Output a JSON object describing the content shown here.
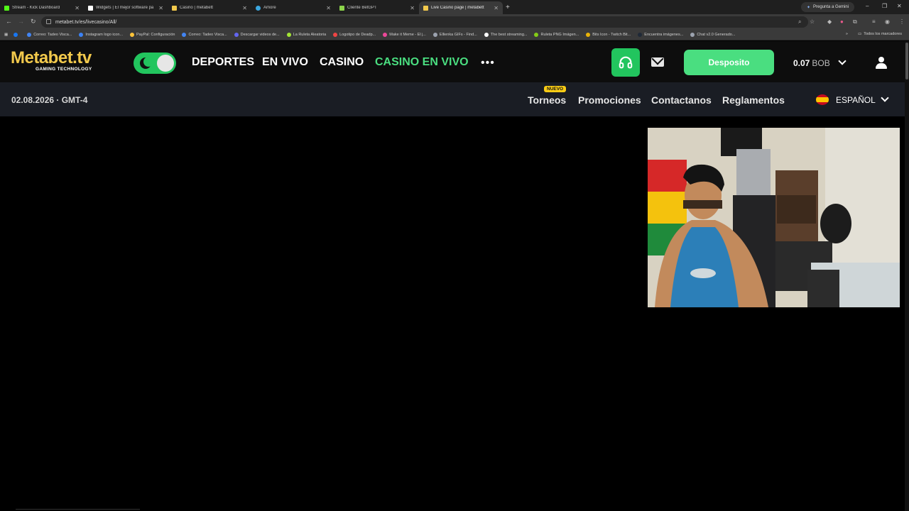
{
  "browser": {
    "tabs": [
      {
        "title": "Stream - Kick Dashboard",
        "color": "#53fc18"
      },
      {
        "title": "Widgets | El mejor software pa",
        "color": "#ffffff"
      },
      {
        "title": "Casino | metabett",
        "color": "#f2c94c"
      },
      {
        "title": "Amore",
        "color": "#3ba7e0"
      },
      {
        "title": "Cliente BetGPT",
        "color": "#8bd34a"
      },
      {
        "title": "Live Casino page | metabett",
        "color": "#f2c94c"
      }
    ],
    "gemini_label": "Pregunta a Gemini",
    "url": "metabet.tv/es/livecasino/All/",
    "bookmarks": [
      "Correo: Tadeo Visca...",
      "Instagram logo icon...",
      "PayPal: Configuración",
      "Correo: Tadeo Visca...",
      "Descargar videos de...",
      "La Ruleta Aleatoria",
      "Logotipo de Deadp...",
      "Make it Meme - El j...",
      "Ellienka GIFs - Find...",
      "The best streaming...",
      "Ruleta PNG Imágen...",
      "Bits Icon - Twitch Bit...",
      "Encuentra imágenes...",
      "Chat v2.0 Generado..."
    ],
    "all_bookmarks": "Todos los marcadores"
  },
  "site": {
    "logo_name": "Metabet.tv",
    "logo_tagline": "GAMING TECHNOLOGY",
    "nav": [
      "DEPORTES",
      "EN VIVO",
      "CASINO",
      "CASINO EN VIVO"
    ],
    "more": "•••",
    "deposit_label": "Desposito",
    "balance_amount": "0.07",
    "balance_currency": "BOB",
    "date": "02.08.2026 · GMT-4",
    "subnav": [
      "Torneos",
      "Promociones",
      "Contactanos",
      "Reglamentos"
    ],
    "badge": "NUEVO",
    "language": "ESPAÑOL"
  },
  "colors": {
    "brand_yellow": "#f2c94c",
    "accent_green": "#4ade80"
  }
}
